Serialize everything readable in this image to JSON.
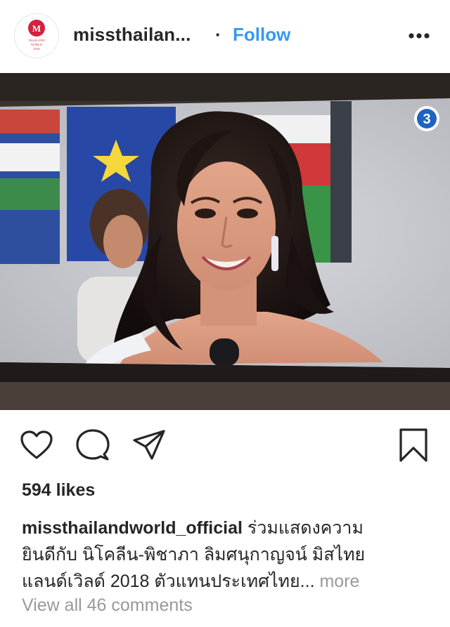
{
  "header": {
    "username": "missthailan...",
    "separator": "·",
    "follow_label": "Follow",
    "avatar_logo_letter": "M",
    "avatar_logo_lines": [
      "THAILAND",
      "WORLD",
      "2018"
    ],
    "more_icon": "more-dots-icon"
  },
  "photo": {
    "description_icon": "tv-screen-photo",
    "channel_badge": "3"
  },
  "actions": {
    "like_icon": "heart-icon",
    "comment_icon": "comment-icon",
    "share_icon": "share-icon",
    "save_icon": "bookmark-icon"
  },
  "likes": "594 likes",
  "caption": {
    "username": "missthailandworld_official",
    "line1": " ร่วมแสดงความ",
    "line2": "ยินดีกับ นิโคลีน-พิชาภา ลิมศนุกาญจน์ มิสไทย",
    "line3": "แลนด์เวิลด์ 2018 ตัวแทนประเทศไทย...",
    "more_label": " more"
  },
  "comments_link": "View all 46 comments",
  "colors": {
    "accent": "#3897f0",
    "text": "#262626",
    "muted": "#999999",
    "logo_red": "#d4213d"
  }
}
